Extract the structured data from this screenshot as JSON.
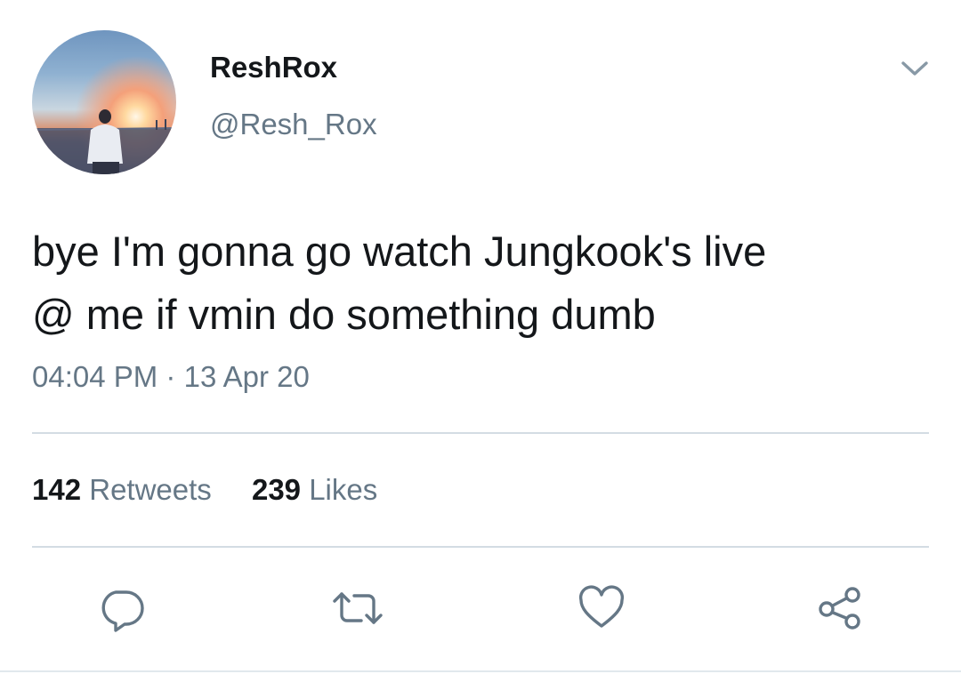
{
  "tweet": {
    "display_name": "ReshRox",
    "handle": "@Resh_Rox",
    "text_lines": [
      "bye I'm gonna go watch Jungkook's live",
      "@ me if vmin do something dumb"
    ],
    "time": "04:04 PM",
    "separator": "·",
    "date": "13 Apr 20"
  },
  "stats": {
    "retweets_count": "142",
    "retweets_label": "Retweets",
    "likes_count": "239",
    "likes_label": "Likes"
  },
  "icons": {
    "caret": "chevron-down-icon",
    "reply": "reply-icon",
    "retweet": "retweet-icon",
    "like": "heart-icon",
    "share": "share-icon"
  },
  "colors": {
    "text_primary": "#14171a",
    "text_secondary": "#657786",
    "divider": "#d3dce3"
  }
}
